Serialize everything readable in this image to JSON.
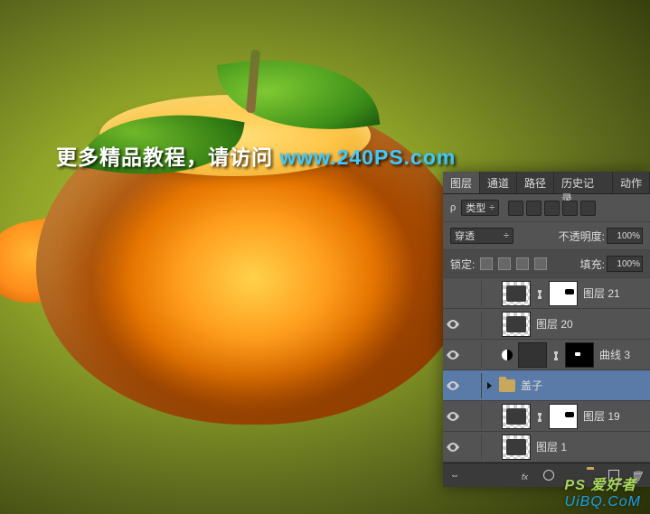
{
  "overlay": {
    "white": "更多精品教程，请访问 ",
    "cyan": "www.240PS.com"
  },
  "panel": {
    "tabs": [
      "图层",
      "通道",
      "路径",
      "历史记录",
      "动作"
    ],
    "active_tab": 0,
    "kind_label": "类型",
    "blend_mode": "穿透",
    "opacity_label": "不透明度:",
    "opacity_value": "100%",
    "lock_label": "锁定:",
    "fill_label": "填充:",
    "fill_value": "100%"
  },
  "layers": [
    {
      "visible": false,
      "indent": true,
      "thumb": "trans",
      "mask": "white",
      "name": "图层 21"
    },
    {
      "visible": true,
      "indent": true,
      "thumb": "trans",
      "name": "图层 20"
    },
    {
      "visible": true,
      "indent": true,
      "adj": true,
      "thumb": "curve",
      "mask": "black",
      "name": "曲线 3"
    },
    {
      "visible": true,
      "folder": true,
      "expanded": false,
      "selected": true,
      "name": "盖子"
    },
    {
      "visible": true,
      "indent": true,
      "thumb": "trans",
      "mask": "white",
      "name": "图层 19"
    },
    {
      "visible": true,
      "indent": true,
      "thumb": "trans",
      "name": "图层 1"
    }
  ],
  "footer": {
    "icons": [
      "fx-icon",
      "mask-icon",
      "adjust-icon",
      "group-icon",
      "new-icon",
      "trash-icon"
    ]
  },
  "watermark": {
    "ps": "PS 爱好者",
    "url": "UiBQ.CoM"
  }
}
